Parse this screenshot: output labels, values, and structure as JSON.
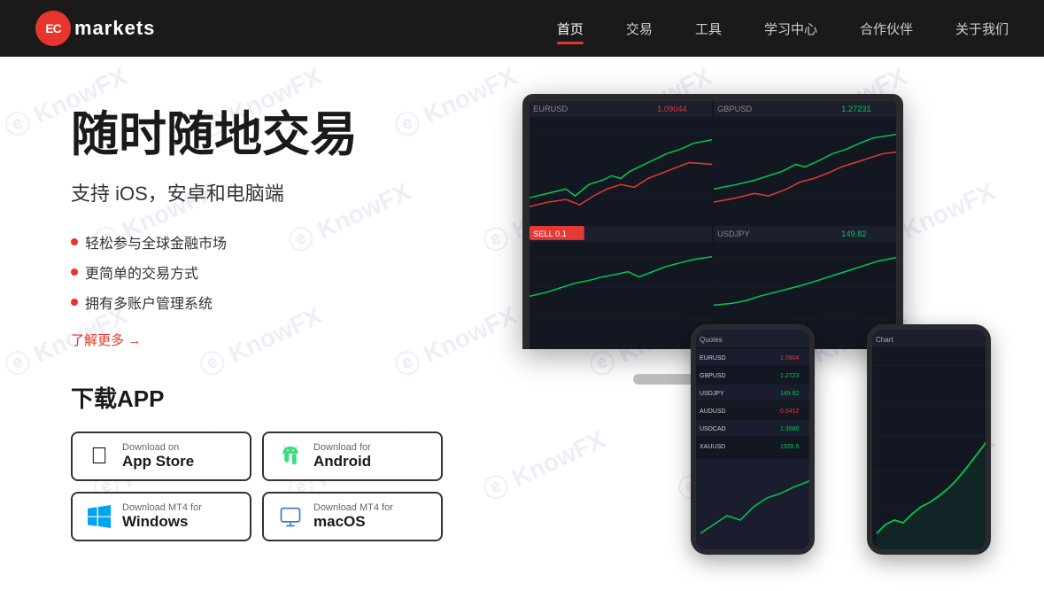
{
  "logo": {
    "circle_text": "EC",
    "name": "markets"
  },
  "nav": {
    "items": [
      {
        "label": "首页",
        "active": true
      },
      {
        "label": "交易",
        "active": false
      },
      {
        "label": "工具",
        "active": false
      },
      {
        "label": "学习中心",
        "active": false
      },
      {
        "label": "合作伙伴",
        "active": false
      },
      {
        "label": "关于我们",
        "active": false
      }
    ]
  },
  "hero": {
    "title": "随时随地交易",
    "subtitle": "支持 iOS，安卓和电脑端",
    "features": [
      "轻松参与全球金融市场",
      "更简单的交易方式",
      "拥有多账户管理系统"
    ],
    "learn_more": "了解更多 →",
    "download_title": "下载APP",
    "buttons": [
      {
        "label": "Download on",
        "name": "App Store",
        "type": "apple"
      },
      {
        "label": "Download for",
        "name": "Android",
        "type": "android"
      },
      {
        "label": "Download MT4 for",
        "name": "Windows",
        "type": "windows"
      },
      {
        "label": "Download MT4 for",
        "name": "macOS",
        "type": "macos"
      }
    ]
  },
  "watermark": {
    "text": "KnowFX",
    "prefix": "ⓔ"
  }
}
